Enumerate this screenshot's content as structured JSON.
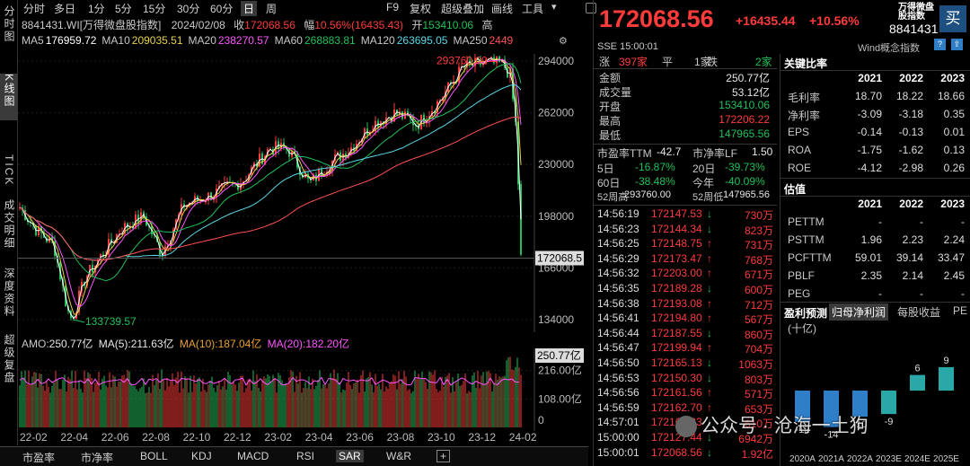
{
  "left_nav": [
    "分时图",
    "K线图",
    "TICK",
    "成交明细",
    "深度资料",
    "超级复盘"
  ],
  "toolbar": {
    "periods": [
      "分时",
      "多日",
      "1分",
      "5分",
      "15分",
      "30分",
      "60分",
      "日",
      "周"
    ],
    "active_period": "日",
    "right_items": [
      "F9",
      "复权",
      "超级叠加",
      "画线",
      "工具"
    ]
  },
  "info": {
    "code": "8841431.WI[万得微盘股指数]",
    "date": "2024/02/08",
    "close_label": "收",
    "close": "172068.56",
    "range_label": "幅",
    "range": "10.56%(16435.43)",
    "open_label": "开",
    "open": "153410.06",
    "high_label": "高"
  },
  "ma": [
    {
      "label": "MA5",
      "value": "176959.72",
      "color": "#ffffff"
    },
    {
      "label": "MA10",
      "value": "209035.51",
      "color": "#e8d24a"
    },
    {
      "label": "MA20",
      "value": "238270.57",
      "color": "#ff55ff"
    },
    {
      "label": "MA60",
      "value": "268883.81",
      "color": "#22c05a"
    },
    {
      "label": "MA120",
      "value": "263695.05",
      "color": "#5ad8e6"
    },
    {
      "label": "MA250",
      "value": "2449",
      "color": "#ff5050"
    }
  ],
  "price_axis": [
    "294000",
    "262000",
    "230000",
    "198000",
    "166000",
    "134000"
  ],
  "annotations": {
    "high": "293760.00",
    "low": "133739.57",
    "current": "172068.5"
  },
  "volume": {
    "amo_label": "AMO:",
    "amo": "250.77亿",
    "ma5_label": "MA(5):",
    "ma5": "211.63亿",
    "ma10_label": "MA(10):",
    "ma10": "187.04亿",
    "ma20_label": "MA(20):",
    "ma20": "182.20亿",
    "axis": [
      "216.00亿",
      "108.00亿"
    ],
    "current": "250.77亿"
  },
  "x_axis": [
    "22-02",
    "22-04",
    "22-06",
    "22-08",
    "22-10",
    "22-12",
    "23-02",
    "23-04",
    "23-06",
    "23-08",
    "23-10",
    "23-12",
    "24-02"
  ],
  "bottom_tabs": [
    "市盈率",
    "市净率",
    "BOLL",
    "KDJ",
    "MACD",
    "RSI",
    "SAR",
    "W&R"
  ],
  "active_tab": "SAR",
  "quote": {
    "price": "172068.56",
    "change": "+16435.44",
    "change_pct": "+10.56%",
    "name": "万得微盘股指数",
    "code": "8841431",
    "buy_label": "买",
    "exchange": "SSE",
    "time": "15:00:01",
    "concept_label": "Wind概念指数",
    "up_label": "涨",
    "up_count": "397家",
    "flat_label": "平",
    "flat_count": "1家",
    "down_label": "跌",
    "down_count": "2家",
    "fields": [
      {
        "label": "金额",
        "value": "250.77亿",
        "color": "#e6e6e6"
      },
      {
        "label": "成交量",
        "value": "53.12亿",
        "color": "#e6e6e6"
      },
      {
        "label": "开盘",
        "value": "153410.06",
        "color": "#22c05a"
      },
      {
        "label": "最高",
        "value": "172206.22",
        "color": "#ff3b3b"
      },
      {
        "label": "最低",
        "value": "147965.56",
        "color": "#22c05a"
      }
    ],
    "pe_label": "市盈率TTM",
    "pe": "-42.7",
    "pb_label": "市净率LF",
    "pb": "1.50",
    "perf": [
      {
        "l1": "5日",
        "v1": "-16.87%",
        "l2": "20日",
        "v2": "-39.73%"
      },
      {
        "l1": "60日",
        "v1": "-38.48%",
        "l2": "今年",
        "v2": "-40.09%"
      }
    ],
    "w52h_label": "52周高",
    "w52h": "293760.00",
    "w52l_label": "52周低",
    "w52l": "147965.56",
    "ticks": [
      {
        "t": "14:56:19",
        "p": "172147.53",
        "d": "down",
        "v": "730万"
      },
      {
        "t": "14:56:23",
        "p": "172144.34",
        "d": "down",
        "v": "823万"
      },
      {
        "t": "14:56:25",
        "p": "172148.75",
        "d": "up",
        "v": "731万"
      },
      {
        "t": "14:56:29",
        "p": "172173.47",
        "d": "up",
        "v": "768万"
      },
      {
        "t": "14:56:32",
        "p": "172203.00",
        "d": "up",
        "v": "671万"
      },
      {
        "t": "14:56:35",
        "p": "172189.28",
        "d": "down",
        "v": "600万"
      },
      {
        "t": "14:56:38",
        "p": "172193.08",
        "d": "up",
        "v": "712万"
      },
      {
        "t": "14:56:41",
        "p": "172194.80",
        "d": "up",
        "v": "567万"
      },
      {
        "t": "14:56:44",
        "p": "172187.55",
        "d": "down",
        "v": "860万"
      },
      {
        "t": "14:56:47",
        "p": "172199.94",
        "d": "up",
        "v": "704万"
      },
      {
        "t": "14:56:50",
        "p": "172165.13",
        "d": "down",
        "v": "1063万"
      },
      {
        "t": "14:56:53",
        "p": "172150.30",
        "d": "down",
        "v": "803万"
      },
      {
        "t": "14:56:56",
        "p": "172161.56",
        "d": "up",
        "v": "571万"
      },
      {
        "t": "14:56:59",
        "p": "172162.70",
        "d": "up",
        "v": "653万"
      },
      {
        "t": "14:57:01",
        "p": "172162.33",
        "d": "down",
        "v": "610万"
      },
      {
        "t": "15:00:00",
        "p": "172127.44",
        "d": "down",
        "v": "6942万"
      },
      {
        "t": "15:00:01",
        "p": "172068.56",
        "d": "down",
        "v": "1.92亿"
      }
    ]
  },
  "ratios": {
    "title": "关键比率",
    "years": [
      "2021",
      "2022",
      "2023"
    ],
    "rows": [
      {
        "label": "毛利率",
        "v": [
          "18.70",
          "18.22",
          "18.66"
        ]
      },
      {
        "label": "净利率",
        "v": [
          "-3.09",
          "-3.18",
          "0.35"
        ]
      },
      {
        "label": "EPS",
        "v": [
          "-0.14",
          "-0.13",
          "0.01"
        ]
      },
      {
        "label": "ROA",
        "v": [
          "-1.75",
          "-1.62",
          "0.13"
        ]
      },
      {
        "label": "ROE",
        "v": [
          "-4.12",
          "-2.98",
          "0.26"
        ]
      }
    ]
  },
  "valuation": {
    "title": "估值",
    "years": [
      "2021",
      "2022",
      "2023"
    ],
    "rows": [
      {
        "label": "PETTM",
        "v": [
          "-",
          "-",
          "-"
        ]
      },
      {
        "label": "PSTTM",
        "v": [
          "1.96",
          "2.23",
          "2.24"
        ]
      },
      {
        "label": "PCFTTM",
        "v": [
          "59.01",
          "39.14",
          "33.47"
        ]
      },
      {
        "label": "PBLF",
        "v": [
          "2.35",
          "2.14",
          "2.45"
        ]
      },
      {
        "label": "PEG",
        "v": [
          "-",
          "-",
          "-"
        ]
      }
    ]
  },
  "profit": {
    "title": "盈利预测",
    "tabs": [
      "归母净利润",
      "每股收益",
      "PE"
    ],
    "unit": "(十亿)",
    "chart_data": {
      "type": "bar",
      "categories": [
        "2020A",
        "2021A",
        "2022A",
        "2023E",
        "2024E",
        "2025E"
      ],
      "values": [
        -12,
        -14,
        -10,
        -9,
        6,
        9
      ],
      "labels": [
        "-12",
        "-14",
        "-10",
        "-9",
        "6",
        "9"
      ],
      "colors": [
        "#2e7ec8",
        "#2e7ec8",
        "#2e7ec8",
        "#2aa8a8",
        "#2aa8a8",
        "#2aa8a8"
      ]
    }
  },
  "watermark": "公众号 · 沧海一土狗",
  "colors": {
    "up": "#ff3b3b",
    "down": "#22c05a",
    "accent": "#2e7ec8"
  }
}
